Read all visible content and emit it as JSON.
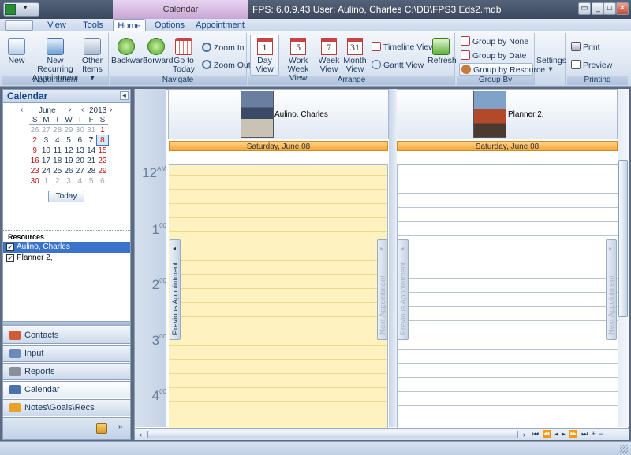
{
  "window": {
    "context_tab": "Calendar",
    "title": "FPS: 6.0.9.43   User: Aulino, Charles    C:\\DB\\FPS3 Eds2.mdb",
    "controls": [
      "▭",
      "_",
      "□",
      "✕"
    ]
  },
  "tabs": [
    {
      "label": "View"
    },
    {
      "label": "Tools"
    },
    {
      "label": "Home"
    },
    {
      "label": "Options"
    },
    {
      "label": "Appointment"
    }
  ],
  "ribbon": {
    "appointment": {
      "caption": "Appointment",
      "new": "New",
      "new_recurring": "New Recurring Appointment",
      "other_items": "Other Items ▾"
    },
    "navigate": {
      "caption": "Navigate",
      "backward": "Backward",
      "forward": "Forward",
      "goto_today": "Go to Today",
      "zoom_in": "Zoom In",
      "zoom_out": "Zoom Out",
      "today_num": ""
    },
    "arrange": {
      "caption": "Arrange",
      "day_view": "Day View",
      "day_num": "1",
      "work_week": "Work Week View",
      "work_week_num": "5",
      "week": "Week View",
      "week_num": "7",
      "month": "Month View",
      "month_num": "31",
      "timeline": "Timeline View",
      "gantt": "Gantt View",
      "refresh": "Refresh"
    },
    "groupby": {
      "caption": "Group By",
      "none": "Group by None",
      "date": "Group by Date",
      "resource": "Group by Resource"
    },
    "settings": {
      "label": "Settings ▾"
    },
    "printing": {
      "caption": "Printing",
      "print": "Print",
      "preview": "Preview"
    }
  },
  "sidebar": {
    "header": "Calendar",
    "collapse": "◂",
    "mini_calendar": {
      "month": "June",
      "year": "2013",
      "prev": "‹",
      "next": "›",
      "weekdays": [
        "S",
        "M",
        "T",
        "W",
        "T",
        "F",
        "S"
      ],
      "weeks": [
        [
          "26",
          "27",
          "28",
          "29",
          "30",
          "31",
          "1"
        ],
        [
          "2",
          "3",
          "4",
          "5",
          "6",
          "7",
          "8"
        ],
        [
          "9",
          "10",
          "11",
          "12",
          "13",
          "14",
          "15"
        ],
        [
          "16",
          "17",
          "18",
          "19",
          "20",
          "21",
          "22"
        ],
        [
          "23",
          "24",
          "25",
          "26",
          "27",
          "28",
          "29"
        ],
        [
          "30",
          "1",
          "2",
          "3",
          "4",
          "5",
          "6"
        ]
      ],
      "today_button": "Today"
    },
    "resources_header": "Resources",
    "resources": [
      {
        "name": "Aulino, Charles",
        "checked": true,
        "selected": true
      },
      {
        "name": "Planner 2,",
        "checked": true,
        "selected": false
      }
    ],
    "nav": [
      {
        "label": "Contacts",
        "icon": "contacts-icon"
      },
      {
        "label": "Input",
        "icon": "input-icon"
      },
      {
        "label": "Reports",
        "icon": "reports-icon"
      },
      {
        "label": "Calendar",
        "icon": "calendar-icon"
      },
      {
        "label": "Notes\\Goals\\Recs",
        "icon": "notes-icon"
      }
    ]
  },
  "calendar": {
    "hours": [
      {
        "h": "12",
        "m": "AM"
      },
      {
        "h": "1",
        "m": "00"
      },
      {
        "h": "2",
        "m": "00"
      },
      {
        "h": "3",
        "m": "00"
      },
      {
        "h": "4",
        "m": "00"
      }
    ],
    "resources": [
      {
        "name": "Aulino, Charles",
        "date": "Saturday, June 08",
        "prev": "Previous Appointment",
        "next": "Next Appointment"
      },
      {
        "name": "Planner 2,",
        "date": "Saturday, June 08",
        "prev": "Previous Appointment",
        "next": "Next Appointment"
      }
    ]
  },
  "hscroll": {
    "nav": "⏮  ⏪  ◂  ▸  ⏩  ⏭  +  −"
  },
  "colors": {
    "accent": "#f4a53a",
    "work_hours": "#fdf2c0",
    "frame": "#8ba0bc"
  }
}
